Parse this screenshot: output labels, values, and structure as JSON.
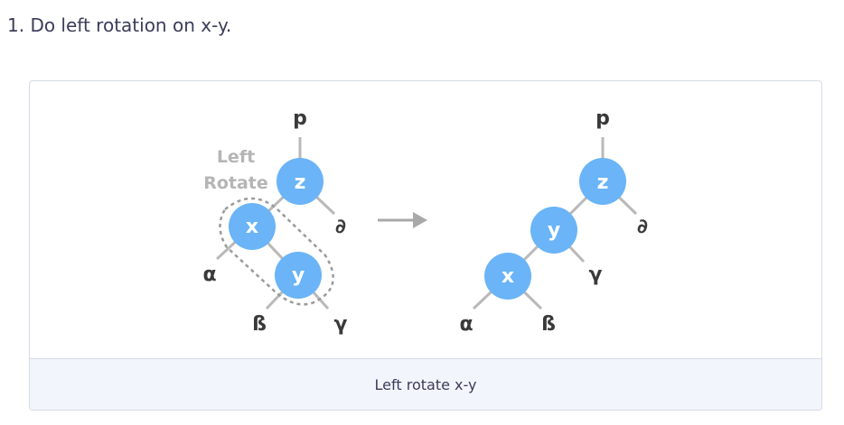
{
  "step": {
    "text": "1. Do left rotation on x-y."
  },
  "figure": {
    "caption": "Left rotate x-y",
    "rotate_label_line1": "Left",
    "rotate_label_line2": "Rotate",
    "before": {
      "parent": "p",
      "nodes": {
        "z": "z",
        "x": "x",
        "y": "y"
      },
      "leaves": {
        "delta": "∂",
        "alpha": "α",
        "beta": "ß",
        "gamma": "γ"
      }
    },
    "after": {
      "parent": "p",
      "nodes": {
        "z": "z",
        "y": "y",
        "x": "x"
      },
      "leaves": {
        "delta": "∂",
        "gamma": "γ",
        "alpha": "α",
        "beta": "ß"
      }
    },
    "arrow": "arrow-right-icon",
    "colors": {
      "node": "#6ab4f7",
      "edge": "#b9b9b9",
      "leaf_text": "#3a3a3a",
      "dashed": "#9a9a9a"
    }
  }
}
